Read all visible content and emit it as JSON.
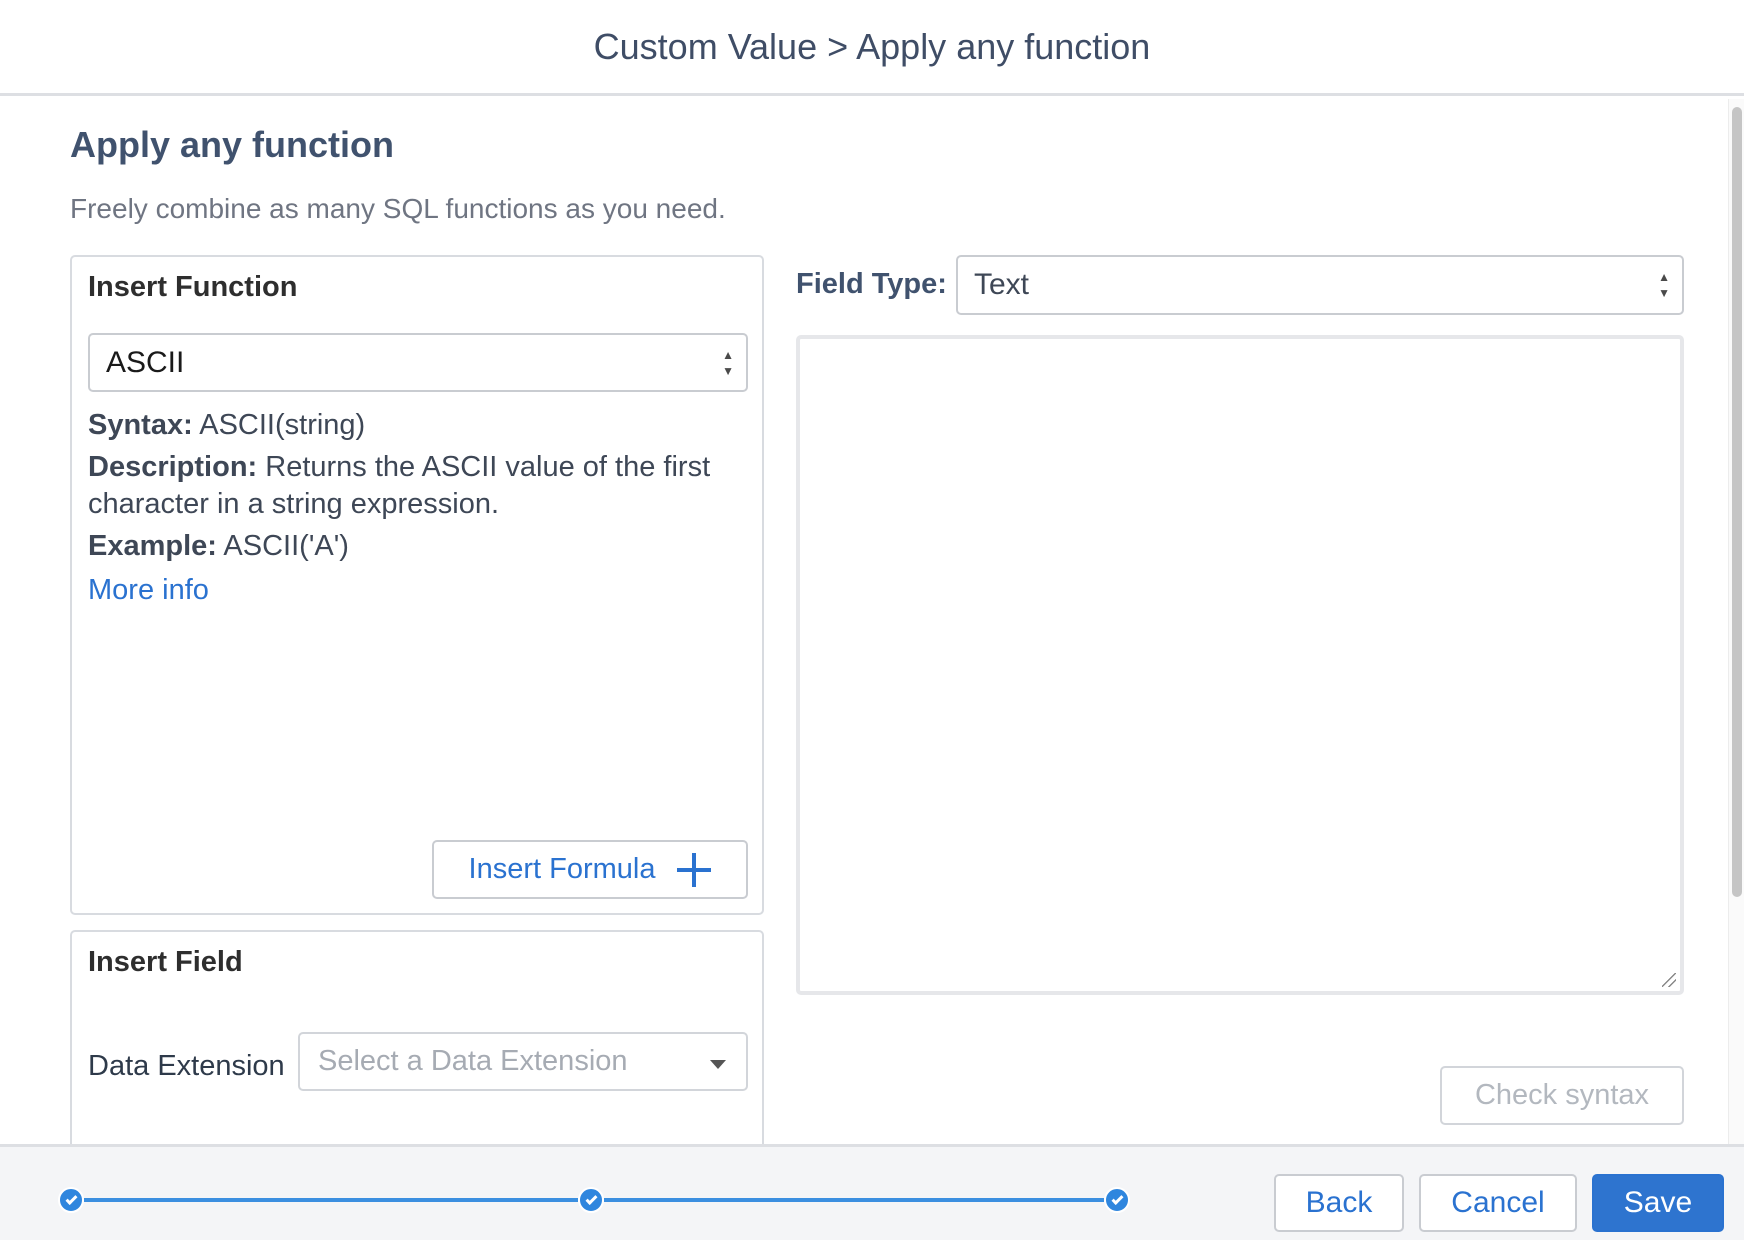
{
  "header": {
    "title": "Custom Value > Apply any function"
  },
  "page": {
    "title": "Apply any function",
    "subtitle": "Freely combine as many SQL functions as you need."
  },
  "insert_function": {
    "heading": "Insert Function",
    "selected_function": "ASCII",
    "syntax_label": "Syntax:",
    "syntax_value": "ASCII(string)",
    "description_label": "Description:",
    "description_value": "Returns the ASCII value of the first character in a string expression.",
    "example_label": "Example:",
    "example_value": "ASCII('A')",
    "more_info": "More info",
    "insert_formula_button": "Insert Formula",
    "insert_formula_icon": "plus-icon"
  },
  "insert_field": {
    "heading": "Insert Field",
    "data_extension_label": "Data Extension",
    "data_extension_placeholder": "Select a Data Extension"
  },
  "field_type": {
    "label": "Field Type:",
    "selected": "Text"
  },
  "formula": {
    "value": ""
  },
  "check_syntax_button": "Check syntax",
  "footer": {
    "steps": [
      {
        "status": "complete",
        "icon": "check-icon"
      },
      {
        "status": "complete",
        "icon": "check-icon"
      },
      {
        "status": "complete",
        "icon": "check-icon"
      }
    ],
    "back_button": "Back",
    "cancel_button": "Cancel",
    "save_button": "Save"
  },
  "colors": {
    "accent": "#2a72d0",
    "save_bg": "#2e74cf",
    "progress": "#2f86de",
    "title_text": "#40526e"
  }
}
